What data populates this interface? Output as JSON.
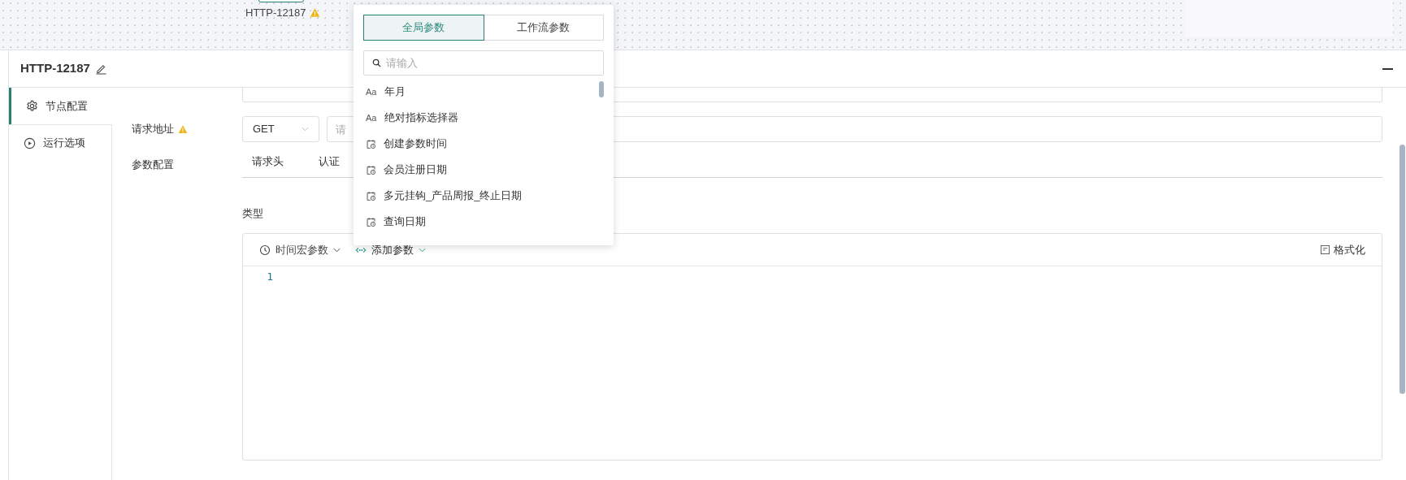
{
  "canvas": {
    "node": {
      "label": "HTTP-12187",
      "warning": true
    }
  },
  "panel": {
    "title": "HTTP-12187"
  },
  "sidebar": {
    "items": [
      {
        "label": "节点配置",
        "kind": "settings",
        "selected": true
      },
      {
        "label": "运行选项",
        "kind": "run",
        "selected": false
      }
    ]
  },
  "form": {
    "url_row": {
      "label": "请求地址",
      "warning": true,
      "method": "GET",
      "url_placeholder": "请"
    },
    "params_row": {
      "label": "参数配置",
      "tabs": [
        {
          "label": "请求头"
        },
        {
          "label": "认证"
        }
      ]
    },
    "type_label": "类型",
    "editor": {
      "toolbar": [
        {
          "label": "时间宏参数",
          "kind": "time"
        },
        {
          "label": "添加参数",
          "kind": "add"
        }
      ],
      "format_button": "格式化",
      "line_numbers": [
        "1"
      ]
    }
  },
  "dropdown": {
    "tabs": [
      {
        "label": "全局参数",
        "selected": true
      },
      {
        "label": "工作流参数",
        "selected": false
      }
    ],
    "search_placeholder": "请输入",
    "items": [
      {
        "label": "年月",
        "kind": "text",
        "glyph": "Aa"
      },
      {
        "label": "绝对指标选择器",
        "kind": "text",
        "glyph": "Aa"
      },
      {
        "label": "创建参数时间",
        "kind": "date"
      },
      {
        "label": "会员注册日期",
        "kind": "date"
      },
      {
        "label": "多元挂钩_产品周报_终止日期",
        "kind": "date"
      },
      {
        "label": "查询日期",
        "kind": "date"
      }
    ]
  }
}
